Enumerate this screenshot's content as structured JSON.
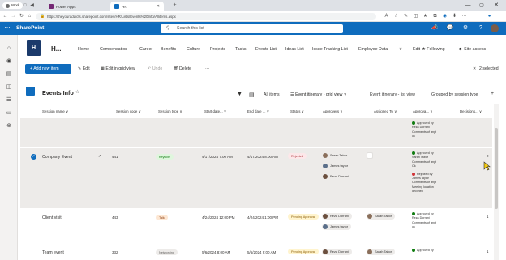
{
  "browser": {
    "profile": "Work",
    "tabs": [
      {
        "label": "Power Apps"
      },
      {
        "label": "HR"
      }
    ],
    "new_tab": "+",
    "url": "https://theyouraddicts.sharepoint.com/sites/HR/Lists/Events%20Info/Allitems.aspx"
  },
  "suite": {
    "app_name": "SharePoint",
    "search_placeholder": "Search this list"
  },
  "site": {
    "logo_letter": "H",
    "name": "H...",
    "nav": [
      "Home",
      "Compensation",
      "Career",
      "Benefits",
      "Culture",
      "Projects",
      "Tasks",
      "Events List",
      "Ideas List",
      "Issue Tracking List",
      "Employee Data",
      "∨",
      "Edit"
    ],
    "following": "Following",
    "site_access": "Site access"
  },
  "commandbar": {
    "new_item": "Add new item",
    "edit": "Edit",
    "edit_grid": "Edit in grid view",
    "undo": "Undo",
    "delete": "Delete",
    "more": "···",
    "close": "✕",
    "selected": "2 selected"
  },
  "list": {
    "title": "Events Info",
    "views": [
      "All items",
      "Event itinerary - grid view",
      "Event itinerary - list view",
      "Grouped by session type"
    ],
    "add_view": "+"
  },
  "columns": [
    "Session name",
    "Session code",
    "Session type",
    "Start date...",
    "End date ...",
    "Status",
    "Approvers",
    "Assigned To",
    "Approva...",
    "Decisions..."
  ],
  "first_partial_row": {
    "approval": [
      "Approved by",
      "Reza Dorrani",
      "Comments of anyt",
      "ok"
    ]
  },
  "rows": [
    {
      "name": "Company Event",
      "code": "441",
      "type": "Keynote",
      "start": "4/17/2024 7:00 AM",
      "end": "4/17/2024 8:00 AM",
      "status": "Rejected",
      "approvers": [
        "Sarah Tabor",
        "James taylor",
        "Reza Dorrani"
      ],
      "approval": [
        "Approved by",
        "Sarah Tabor",
        "Comments of anyt",
        "Ok",
        "",
        "Rejected by",
        "James taylor",
        "Comments of anyt",
        "Meeting location",
        "declined"
      ],
      "decision": "2"
    },
    {
      "name": "Client visit",
      "code": "443",
      "type": "Talk",
      "start": "4/24/2024 12:00 PM",
      "end": "4/24/2024 1:00 PM",
      "status": "Pending Approval",
      "approvers": [
        "Reza Dorrani",
        "James taylor"
      ],
      "assigned": "Sarah Tabor",
      "approval": [
        "Approved by",
        "Reza Dorrani",
        "Comments of anyt",
        "ok"
      ],
      "decision": "1"
    },
    {
      "name": "Team event",
      "code": "332",
      "type": "Networking",
      "start": "5/6/2024 8:00 AM",
      "end": "5/6/2024 9:00 AM",
      "status": "Pending Approval",
      "approvers": [
        "Reza Dorrani"
      ],
      "assigned": "Sarah Tabor",
      "approval": [
        "Approved by"
      ],
      "decision": "1"
    }
  ],
  "colors": {
    "brand": "#0f6cbd",
    "approved": "#107c10",
    "rejected": "#d13438",
    "selected_row": "#edebe9"
  }
}
